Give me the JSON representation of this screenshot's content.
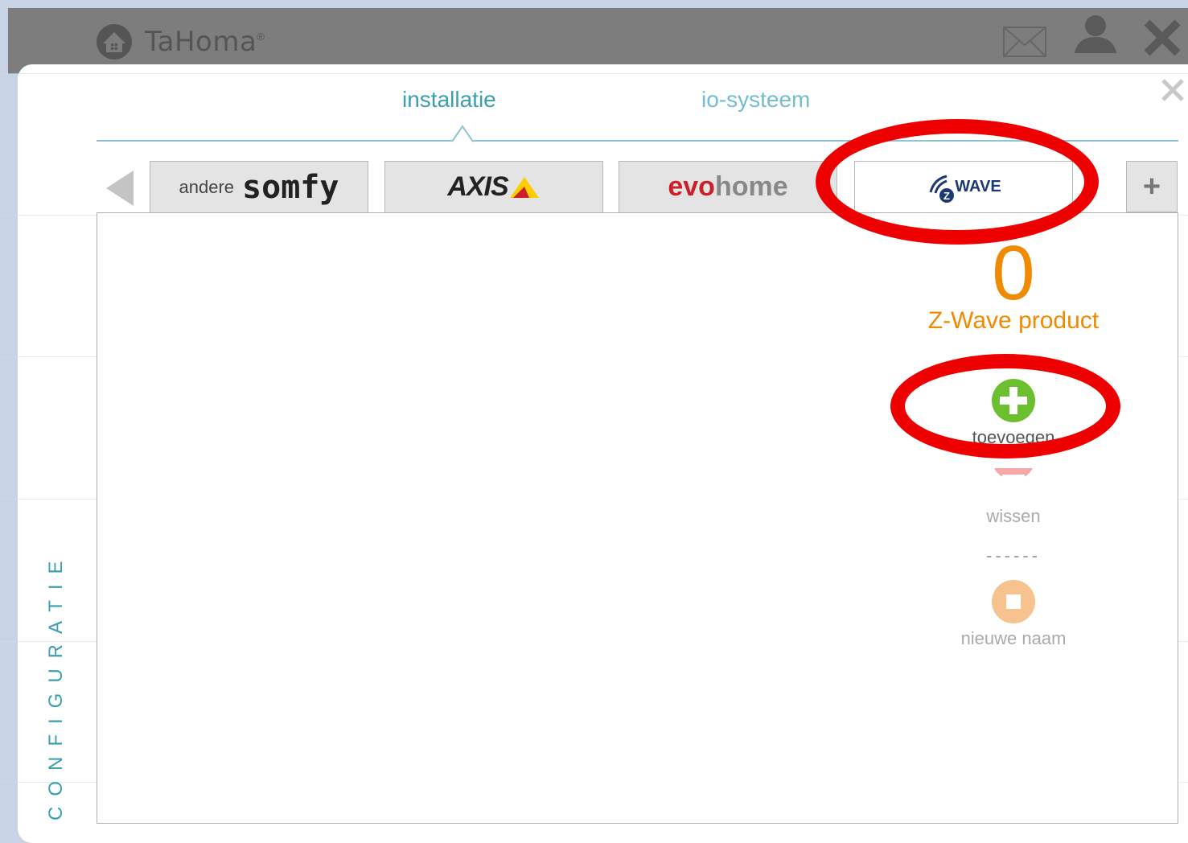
{
  "app": {
    "title": "TaHoma",
    "trademark": "®"
  },
  "header_icons": [
    "mail-icon",
    "user-icon",
    "close-icon"
  ],
  "main_tabs": [
    {
      "label": "installatie",
      "active": true
    },
    {
      "label": "io-systeem",
      "active": false
    }
  ],
  "brand_tabs": [
    {
      "id": "somfy",
      "prefix": "andere",
      "label": "somfy",
      "active": false
    },
    {
      "id": "axis",
      "label": "AXIS",
      "active": false
    },
    {
      "id": "evohome",
      "label_a": "evo",
      "label_b": "home",
      "active": false
    },
    {
      "id": "zwave",
      "label": "WAVE",
      "badge": "Z",
      "active": true
    }
  ],
  "add_tab_label": "+",
  "sidebar_label": "CONFIGURATIE",
  "product": {
    "count": "0",
    "label": "Z-Wave product"
  },
  "actions": {
    "add": {
      "label": "toevoegen"
    },
    "delete": {
      "label": "wissen"
    },
    "separator": "------",
    "rename": {
      "label": "nieuwe naam"
    }
  },
  "colors": {
    "accent": "#3a9fb0",
    "orange": "#f08a00",
    "green": "#6cc030",
    "highlight": "#ee0000"
  }
}
